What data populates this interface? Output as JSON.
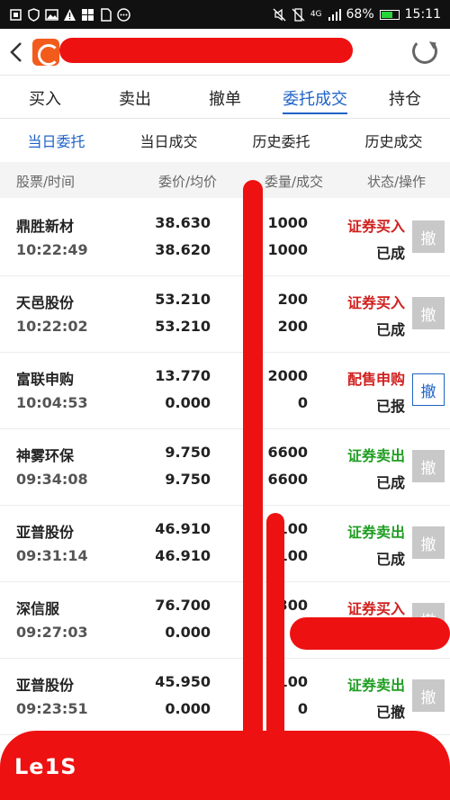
{
  "statusbar": {
    "battery": "68%",
    "time": "15:11",
    "network": "4G"
  },
  "tabs": [
    "买入",
    "卖出",
    "撤单",
    "委托成交",
    "持仓"
  ],
  "active_tab": 3,
  "subtabs": [
    "当日委托",
    "当日成交",
    "历史委托",
    "历史成交"
  ],
  "active_subtab": 0,
  "table_header": {
    "col1": "股票/时间",
    "col2": "委价/均价",
    "col3": "委量/成交",
    "col4": "状态/操作"
  },
  "cancel_label": "撤",
  "rows": [
    {
      "name": "鼎胜新材",
      "time": "10:22:49",
      "price": "38.630",
      "avg": "38.620",
      "qty": "1000",
      "deal": "1000",
      "type": "证券买入",
      "side": "buy",
      "state": "已成",
      "cancelable": false
    },
    {
      "name": "天邑股份",
      "time": "10:22:02",
      "price": "53.210",
      "avg": "53.210",
      "qty": "200",
      "deal": "200",
      "type": "证券买入",
      "side": "buy",
      "state": "已成",
      "cancelable": false
    },
    {
      "name": "富联申购",
      "time": "10:04:53",
      "price": "13.770",
      "avg": "0.000",
      "qty": "2000",
      "deal": "0",
      "type": "配售申购",
      "side": "buy",
      "state": "已报",
      "cancelable": true
    },
    {
      "name": "神雾环保",
      "time": "09:34:08",
      "price": "9.750",
      "avg": "9.750",
      "qty": "6600",
      "deal": "6600",
      "type": "证券卖出",
      "side": "sell",
      "state": "已成",
      "cancelable": false
    },
    {
      "name": "亚普股份",
      "time": "09:31:14",
      "price": "46.910",
      "avg": "46.910",
      "qty": "100",
      "deal": "100",
      "type": "证券卖出",
      "side": "sell",
      "state": "已成",
      "cancelable": false
    },
    {
      "name": "深信服",
      "time": "09:27:03",
      "price": "76.700",
      "avg": "0.000",
      "qty": "300",
      "deal": "",
      "type": "证券买入",
      "side": "buy",
      "state": "",
      "cancelable": false
    },
    {
      "name": "亚普股份",
      "time": "09:23:51",
      "price": "45.950",
      "avg": "0.000",
      "qty": "100",
      "deal": "0",
      "type": "证券卖出",
      "side": "sell",
      "state": "已撤",
      "cancelable": false
    }
  ],
  "footer_brand": "Le1S",
  "colors": {
    "accent": "#1f63c6",
    "buy": "#d0201e",
    "sell": "#1f9e22",
    "scribble": "#ee1111"
  }
}
